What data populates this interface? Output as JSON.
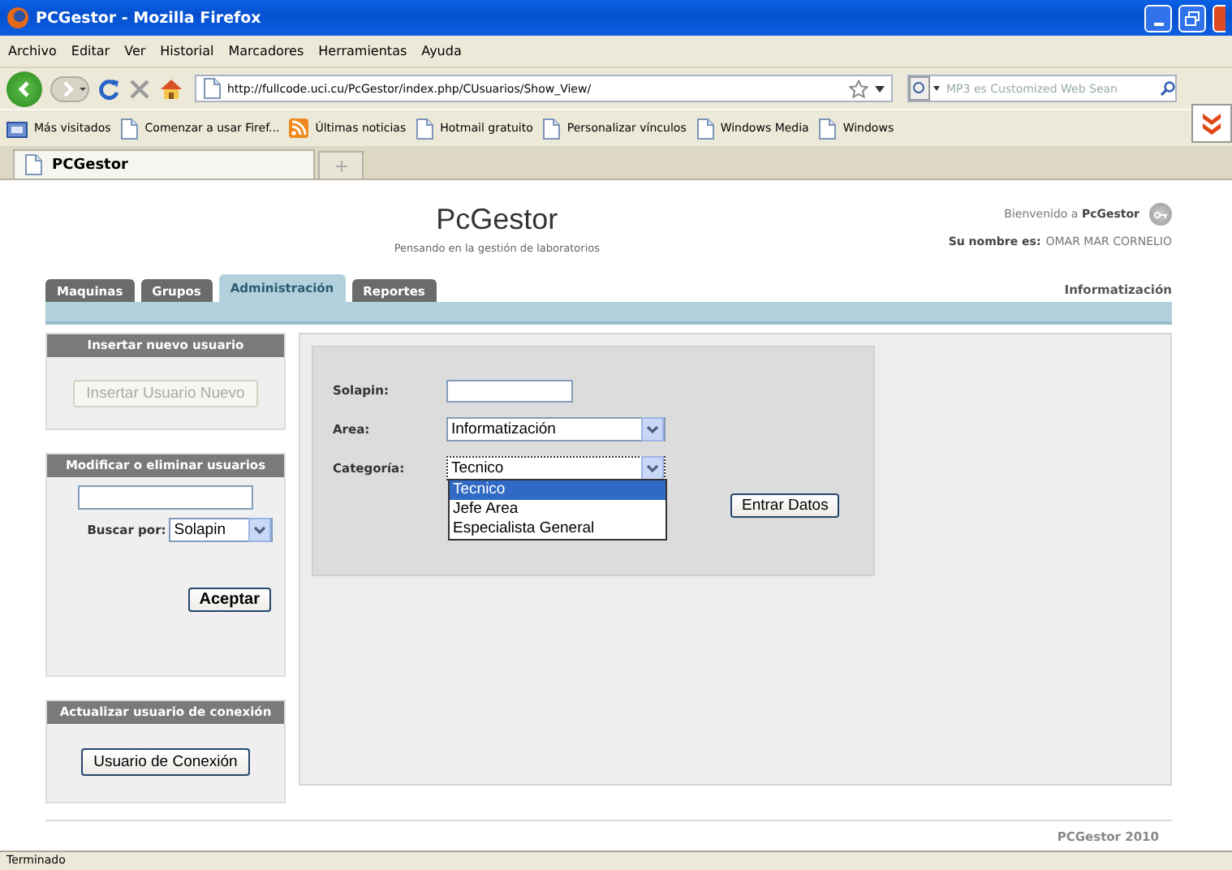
{
  "window": {
    "title": "PCGestor - Mozilla Firefox"
  },
  "menu": [
    "Archivo",
    "Editar",
    "Ver",
    "Historial",
    "Marcadores",
    "Herramientas",
    "Ayuda"
  ],
  "address": {
    "value": "http://fullcode.uci.cu/PcGestor/index.php/CUsuarios/Show_View/"
  },
  "search": {
    "placeholder": "MP3 es Customized Web Sean"
  },
  "bookmarks": [
    {
      "label": "Más visitados",
      "kind": "folder"
    },
    {
      "label": "Comenzar a usar Firef...",
      "kind": "page"
    },
    {
      "label": "Últimas noticias",
      "kind": "feed"
    },
    {
      "label": "Hotmail gratuito",
      "kind": "page"
    },
    {
      "label": "Personalizar vínculos",
      "kind": "page"
    },
    {
      "label": "Windows Media",
      "kind": "page"
    },
    {
      "label": "Windows",
      "kind": "page"
    }
  ],
  "browser_tabs": [
    {
      "label": "PCGestor",
      "selected": true
    }
  ],
  "header": {
    "title": "PcGestor",
    "subtitle": "Pensando en la gestión de laboratorios",
    "welcome": "Bienvenido a **PcGestor**",
    "name_label": "Su nombre es:",
    "name": "OMAR MAR CORNELIO",
    "area": "Informatización"
  },
  "tabs": [
    {
      "label": "Maquinas",
      "selected": false
    },
    {
      "label": "Grupos",
      "selected": false
    },
    {
      "label": "Administración",
      "selected": true
    },
    {
      "label": "Reportes",
      "selected": false
    }
  ],
  "sidebar": {
    "panels": [
      {
        "title": "Insertar nuevo usuario",
        "kind": "action",
        "button": {
          "label": "Insertar Usuario Nuevo",
          "disabled": true
        }
      },
      {
        "title": "Modificar o eliminar usuarios",
        "kind": "search",
        "search_label": "Buscar por:",
        "search_by": "Solapin",
        "button": {
          "label": "Aceptar",
          "disabled": false
        }
      },
      {
        "title": "Actualizar usuario de conexión",
        "kind": "action",
        "button": {
          "label": "Usuario de Conexión",
          "disabled": false
        }
      }
    ]
  },
  "form": {
    "fields": [
      {
        "label": "Solapin:",
        "kind": "text"
      },
      {
        "label": "Area:",
        "kind": "select",
        "value": "Informatización",
        "expanded": false
      },
      {
        "label": "Categoría:",
        "kind": "select",
        "value": "Tecnico",
        "expanded": true,
        "options": [
          {
            "label": "Tecnico",
            "selected": true
          },
          {
            "label": "Jefe Area",
            "selected": false
          },
          {
            "label": "Especialista General",
            "selected": false
          }
        ]
      }
    ],
    "submit": "Entrar Datos"
  },
  "footer": "PCGestor 2010",
  "status_bar": "Terminado"
}
